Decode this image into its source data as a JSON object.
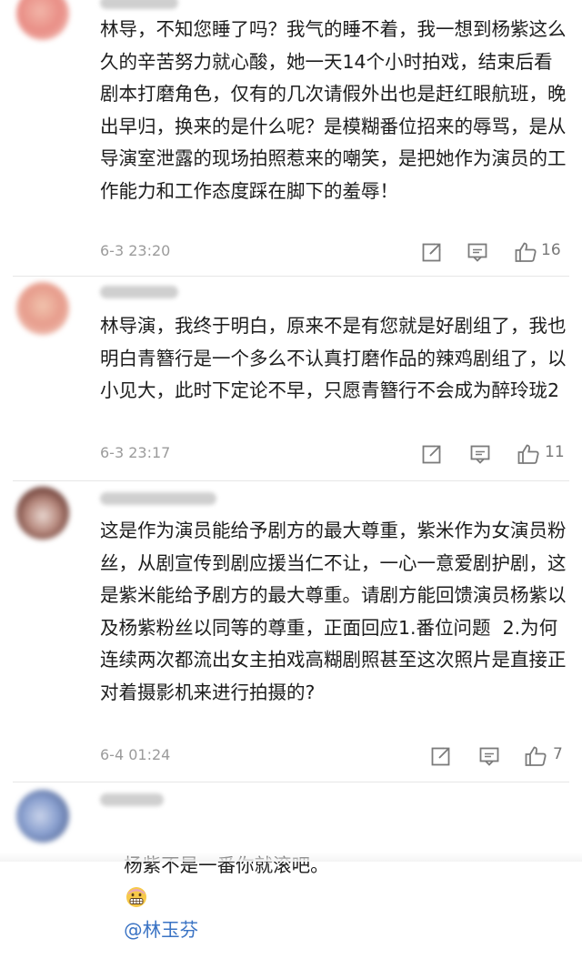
{
  "comments": [
    {
      "text": "林导，不知您睡了吗？我气的睡不着，我一想到杨紫这么久的辛苦努力就心酸，她一天14个小时拍戏，结束后看剧本打磨角色，仅有的几次请假外出也是赶红眼航班，晚出早归，换来的是什么呢？是模糊番位招来的辱骂，是从导演室泄露的现场拍照惹来的嘲笑，是把她作为演员的工作能力和工作态度踩在脚下的羞辱！",
      "time": "6-3 23:20",
      "likes": "16",
      "icons": [
        "share-icon",
        "comment-icon",
        "like-icon"
      ]
    },
    {
      "text": "林导演，我终于明白，原来不是有您就是好剧组了，我也明白青簪行是一个多么不认真打磨作品的辣鸡剧组了，以小见大，此时下定论不早，只愿青簪行不会成为醉玲珑2",
      "time": "6-3 23:17",
      "likes": "11",
      "icons": [
        "share-icon",
        "comment-icon",
        "like-icon"
      ]
    },
    {
      "text": "这是作为演员能给予剧方的最大尊重，紫米作为女演员粉丝，从剧宣传到剧应援当仁不让，一心一意爱剧护剧，这是紫米能给予剧方的最大尊重。请剧方能回馈演员杨紫以及杨紫粉丝以同等的尊重，正面回应1.番位问题  2.为何连续两次都流出女主拍戏高糊剧照甚至这次照片是直接正对着摄影机来进行拍摄的?",
      "time": "6-4 01:24",
      "likes": "7",
      "icons": [
        "share-icon",
        "comment-icon",
        "like-icon"
      ]
    },
    {
      "text_before": "杨紫不是一番你就滚吧。",
      "emoji": "grimacing-face-icon",
      "mention": "@林玉芬",
      "icons": []
    }
  ],
  "colors": {
    "text": "#1d1d1d",
    "meta": "#9b9b9b",
    "mention": "#3a73c4",
    "divider": "#e6e6e6"
  }
}
